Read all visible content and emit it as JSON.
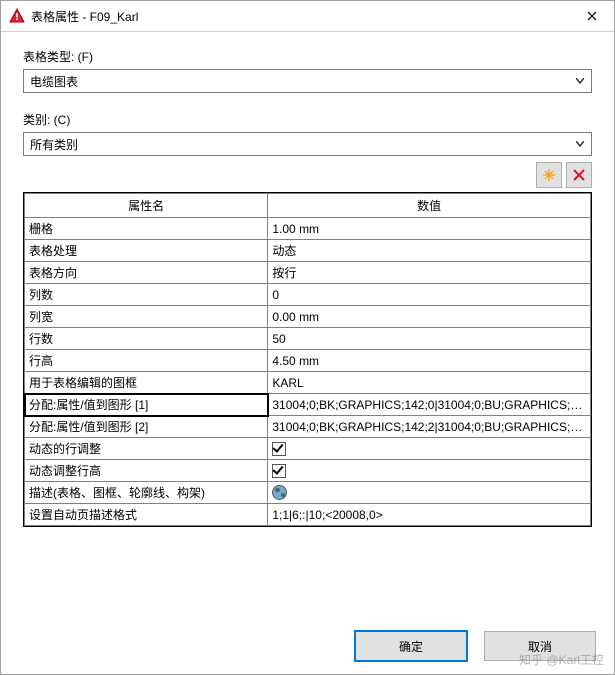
{
  "window": {
    "title": "表格属性 - F09_Karl"
  },
  "form": {
    "type_label": "表格类型: (F)",
    "type_value": "电缆图表",
    "category_label": "类别: (C)",
    "category_value": "所有类别"
  },
  "toolbar": {
    "new_icon": "new-icon",
    "delete_icon": "delete-icon"
  },
  "table": {
    "headers": {
      "name": "属性名",
      "value": "数值"
    },
    "rows": [
      {
        "name": "栅格",
        "value": "1.00 mm",
        "type": "text"
      },
      {
        "name": "表格处理",
        "value": "动态",
        "type": "text"
      },
      {
        "name": "表格方向",
        "value": "按行",
        "type": "text"
      },
      {
        "name": "列数",
        "value": "0",
        "type": "text"
      },
      {
        "name": "列宽",
        "value": "0.00 mm",
        "type": "text"
      },
      {
        "name": "行数",
        "value": "50",
        "type": "text"
      },
      {
        "name": "行高",
        "value": "4.50 mm",
        "type": "text"
      },
      {
        "name": "用于表格编辑的图框",
        "value": "KARL",
        "type": "text"
      },
      {
        "name": "分配:属性/值到图形 [1]",
        "value": "31004;0;BK;GRAPHICS;142;0|31004;0;BU;GRAPHICS;1...",
        "type": "text",
        "selected": true
      },
      {
        "name": "分配:属性/值到图形 [2]",
        "value": "31004;0;BK;GRAPHICS;142;2|31004;0;BU;GRAPHICS;1...",
        "type": "text"
      },
      {
        "name": "动态的行调整",
        "value": "",
        "type": "check"
      },
      {
        "name": "动态调整行高",
        "value": "",
        "type": "check"
      },
      {
        "name": "描述(表格、图框、轮廓线、构架)",
        "value": "",
        "type": "globe"
      },
      {
        "name": "设置自动页描述格式",
        "value": "1;1|6;:|10;<20008,0>",
        "type": "text"
      }
    ]
  },
  "buttons": {
    "ok": "确定",
    "cancel": "取消"
  },
  "watermark": "知乎 @Karl工控"
}
